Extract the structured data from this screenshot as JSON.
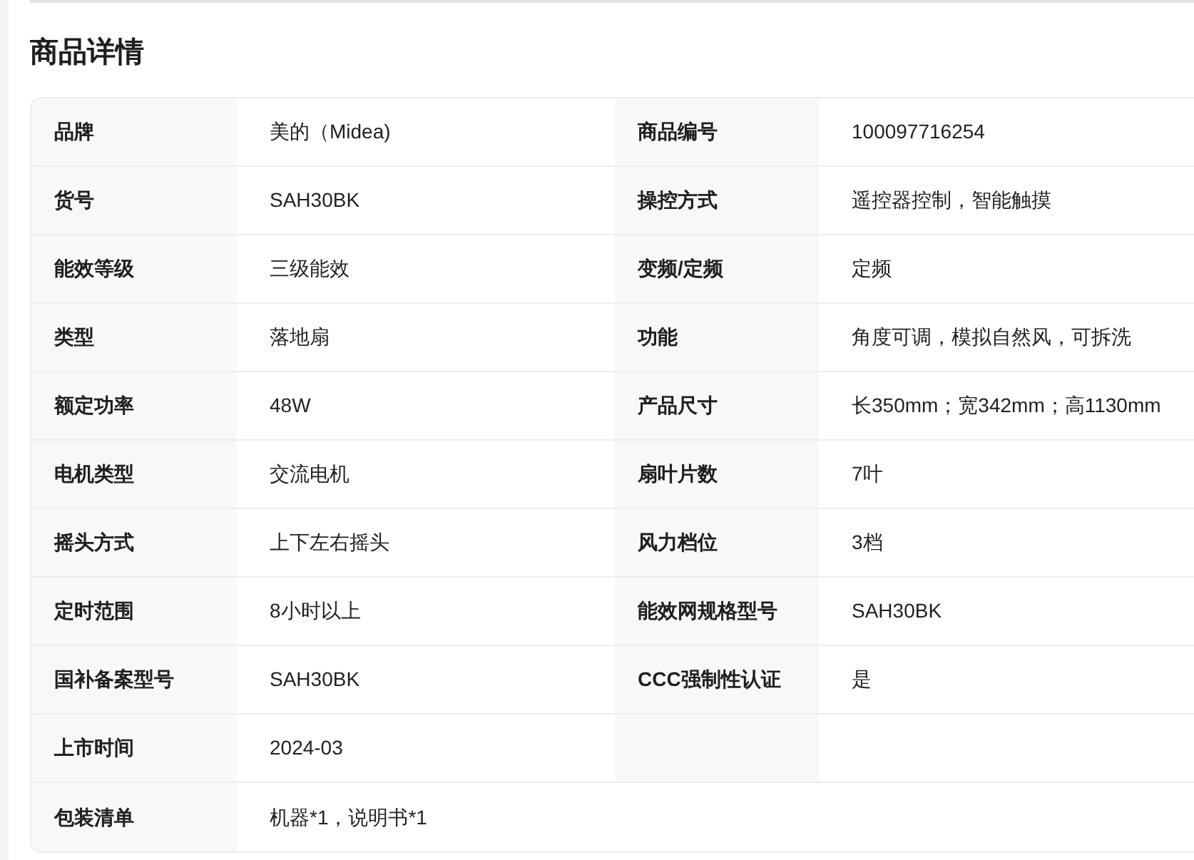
{
  "title": "商品详情",
  "rows": [
    {
      "kind": "pair",
      "cells": [
        {
          "label": "品牌",
          "value": "美的（Midea)"
        },
        {
          "label": "商品编号",
          "value": "100097716254"
        }
      ]
    },
    {
      "kind": "pair",
      "cells": [
        {
          "label": "货号",
          "value": "SAH30BK"
        },
        {
          "label": "操控方式",
          "value": "遥控器控制，智能触摸"
        }
      ]
    },
    {
      "kind": "pair",
      "cells": [
        {
          "label": "能效等级",
          "value": "三级能效"
        },
        {
          "label": "变频/定频",
          "value": "定频"
        }
      ]
    },
    {
      "kind": "pair",
      "cells": [
        {
          "label": "类型",
          "value": "落地扇"
        },
        {
          "label": "功能",
          "value": "角度可调，模拟自然风，可拆洗"
        }
      ]
    },
    {
      "kind": "pair",
      "cells": [
        {
          "label": "额定功率",
          "value": "48W"
        },
        {
          "label": "产品尺寸",
          "value": "长350mm；宽342mm；高1130mm"
        }
      ]
    },
    {
      "kind": "pair",
      "cells": [
        {
          "label": "电机类型",
          "value": "交流电机"
        },
        {
          "label": "扇叶片数",
          "value": "7叶"
        }
      ]
    },
    {
      "kind": "pair",
      "cells": [
        {
          "label": "摇头方式",
          "value": "上下左右摇头"
        },
        {
          "label": "风力档位",
          "value": "3档"
        }
      ]
    },
    {
      "kind": "pair",
      "cells": [
        {
          "label": "定时范围",
          "value": "8小时以上"
        },
        {
          "label": "能效网规格型号",
          "value": "SAH30BK"
        }
      ]
    },
    {
      "kind": "pair",
      "cells": [
        {
          "label": "国补备案型号",
          "value": "SAH30BK"
        },
        {
          "label": "CCC强制性认证",
          "value": "是"
        }
      ]
    },
    {
      "kind": "half",
      "cells": [
        {
          "label": "上市时间",
          "value": "2024-03"
        }
      ]
    },
    {
      "kind": "wide",
      "cells": [
        {
          "label": "包装清单",
          "value": "机器*1，说明书*1"
        }
      ]
    }
  ]
}
